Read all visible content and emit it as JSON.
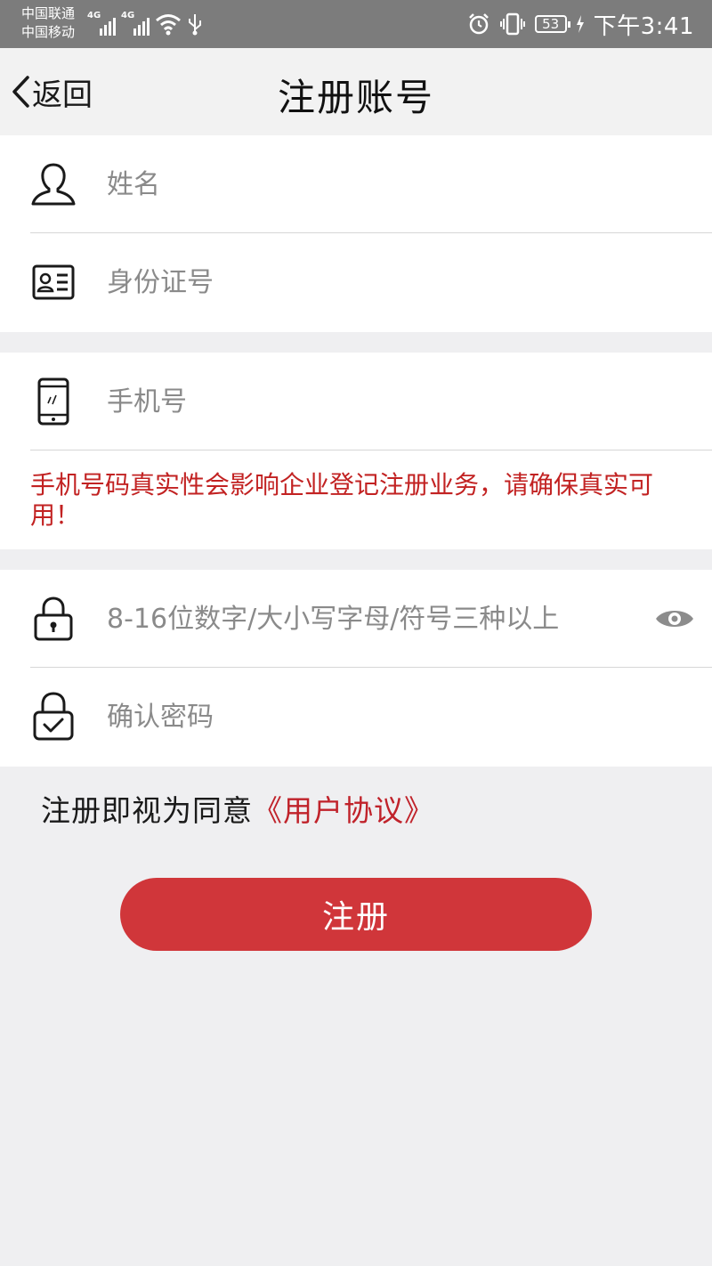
{
  "status_bar": {
    "carrier_1": "中国联通",
    "carrier_2": "中国移动",
    "network_1": "4G",
    "network_2": "4G",
    "battery": "53",
    "time": "下午3:41"
  },
  "header": {
    "back_label": "返回",
    "title": "注册账号"
  },
  "form": {
    "name_placeholder": "姓名",
    "id_placeholder": "身份证号",
    "phone_placeholder": "手机号",
    "phone_warning": "手机号码真实性会影响企业登记注册业务，请确保真实可用！",
    "password_placeholder": "8-16位数字/大小写字母/符号三种以上",
    "confirm_placeholder": "确认密码"
  },
  "agreement": {
    "prefix": "注册即视为同意",
    "link": "《用户协议》"
  },
  "submit_label": "注册",
  "colors": {
    "accent": "#c0222a",
    "button": "#d0363a",
    "warning": "#c22222"
  },
  "icons": {
    "name": "user-icon",
    "id": "id-card-icon",
    "phone": "phone-icon",
    "password": "lock-icon",
    "confirm": "lock-check-icon",
    "toggle": "eye-icon",
    "back": "chevron-left-icon"
  }
}
